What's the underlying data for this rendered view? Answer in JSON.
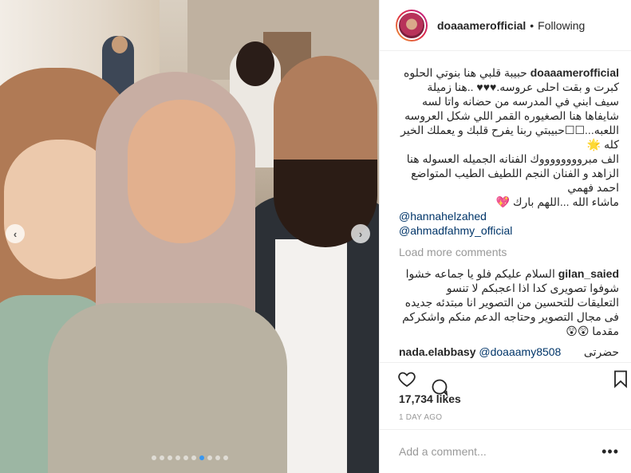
{
  "post": {
    "username": "doaaamerofficial",
    "follow_state": "Following",
    "separator": "•",
    "caption_lines": [
      "حبيبة قلبي هنا بنوتي الحلوه",
      "كبرت و بقت احلى عروسه.♥♥♥ ..هنا زميلة",
      "سيف ابني في المدرسه من حضانه واتا لسه",
      "شايفاها هنا الصغيوره القمر اللي شكل العروسه",
      "اللعبه...☐☐حبيبتي ربنا يفرح قلبك و يعملك الخير",
      "كله 🌟",
      "الف مبرووووووووك الفنانه الجميله العسوله هنا",
      "الزاهد و الفنان النجم اللطيف الطيب المتواضع",
      "احمد فهمي",
      "ماشاء الله ...اللهم بارك 💖"
    ],
    "mentions": [
      "@hannahelzahed",
      "@ahmadfahmy_official"
    ],
    "load_more": "Load more comments",
    "comments": [
      {
        "user": "gilan_saied",
        "lines": [
          "السلام عليكم فلو يا جماعه خشوا",
          "شوفوا تصويرى كدا اذا اعجبكم لا تنسو",
          "التعليقات للتحسين من التصوير انا مبتدئه جديده",
          "فى مجال التصوير وحتاجه الدعم منكم واشكركم",
          "مقدما 😲😲"
        ]
      },
      {
        "user": "nada.elabbasy",
        "mention": "@doaaamy8508",
        "text": "حضرتى"
      }
    ],
    "likes": "17,734 likes",
    "time": "1 DAY AGO",
    "add_comment_placeholder": "Add a comment...",
    "more_label": "•••"
  },
  "carousel": {
    "prev_label": "‹",
    "next_label": "›",
    "dot_count": 10,
    "active_dot": 6
  },
  "icons": {
    "heart": "heart-icon",
    "comment": "comment-icon",
    "save": "bookmark-icon",
    "prev": "chevron-left-icon",
    "next": "chevron-right-icon"
  },
  "colors": {
    "accent": "#3897f0",
    "link": "#003569",
    "muted": "#999999"
  }
}
